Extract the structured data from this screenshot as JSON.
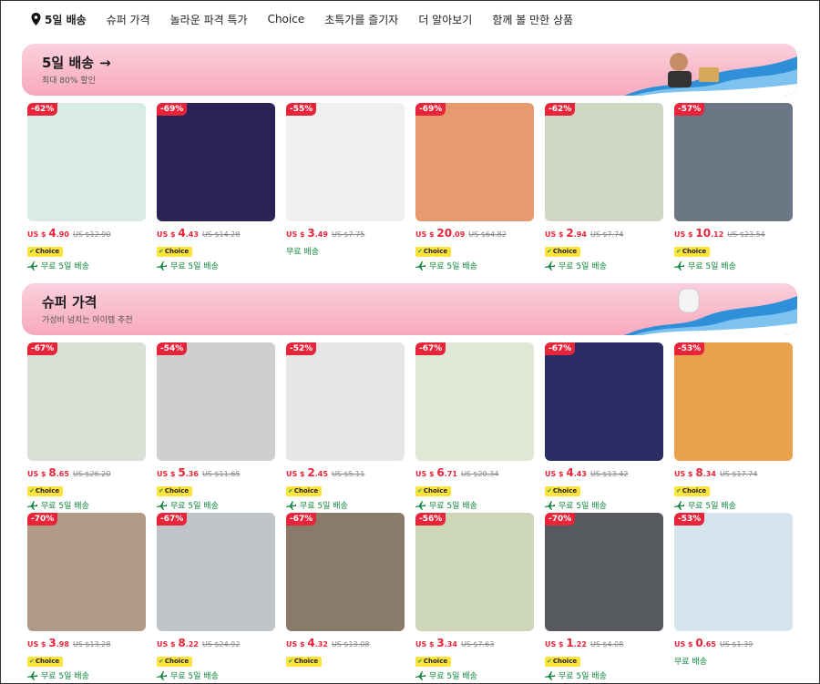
{
  "nav": [
    {
      "label": "5일 배송",
      "active": true
    },
    {
      "label": "슈퍼 가격"
    },
    {
      "label": "놀라운 파격 특가"
    },
    {
      "label": "Choice"
    },
    {
      "label": "초특가를 즐기자"
    },
    {
      "label": "더 알아보기"
    },
    {
      "label": "함께 볼 만한 상품"
    }
  ],
  "banner1": {
    "title": "5일 배송",
    "subtitle": "최대 80% 할인"
  },
  "banner2": {
    "title": "슈퍼 가격",
    "subtitle": "가성비 넘치는 아이템 추천"
  },
  "labels": {
    "currency": "US $",
    "choice": "Choice",
    "ship5": "무료 5일 배송",
    "free_ship": "무료 배송"
  },
  "row1": [
    {
      "discount": "-62%",
      "price_int": "4",
      "price_dec": ".90",
      "old": "US $12.90",
      "choice": true,
      "ship": "무료 5일 배송",
      "color": "#d9ebe5"
    },
    {
      "discount": "-69%",
      "price_int": "4",
      "price_dec": ".43",
      "old": "US $14.28",
      "choice": true,
      "ship": "무료 5일 배송",
      "color": "#2a2356"
    },
    {
      "discount": "-55%",
      "price_int": "3",
      "price_dec": ".49",
      "old": "US $7.75",
      "choice": false,
      "ship": "무료 배송",
      "color": "#efefef"
    },
    {
      "discount": "-69%",
      "price_int": "20",
      "price_dec": ".09",
      "old": "US $64.82",
      "choice": true,
      "ship": "무료 5일 배송",
      "color": "#e79a6d"
    },
    {
      "discount": "-62%",
      "price_int": "2",
      "price_dec": ".94",
      "old": "US $7.74",
      "choice": true,
      "ship": "무료 5일 배송",
      "color": "#cfd6c4"
    },
    {
      "discount": "-57%",
      "price_int": "10",
      "price_dec": ".12",
      "old": "US $23.54",
      "choice": true,
      "ship": "무료 5일 배송",
      "color": "#6b7784"
    }
  ],
  "row2": [
    {
      "discount": "-67%",
      "price_int": "8",
      "price_dec": ".65",
      "old": "US $26.20",
      "choice": true,
      "ship": "무료 5일 배송",
      "color": "#d9e0d6"
    },
    {
      "discount": "-54%",
      "price_int": "5",
      "price_dec": ".36",
      "old": "US $11.65",
      "choice": true,
      "ship": "무료 5일 배송",
      "color": "#cfcfcf"
    },
    {
      "discount": "-52%",
      "price_int": "2",
      "price_dec": ".45",
      "old": "US $5.11",
      "choice": true,
      "ship": "무료 5일 배송",
      "color": "#e6e6e6"
    },
    {
      "discount": "-67%",
      "price_int": "6",
      "price_dec": ".71",
      "old": "US $20.34",
      "choice": true,
      "ship": "무료 5일 배송",
      "color": "#dfe8d6"
    },
    {
      "discount": "-67%",
      "price_int": "4",
      "price_dec": ".43",
      "old": "US $13.42",
      "choice": true,
      "ship": "무료 5일 배송",
      "color": "#2a2d63"
    },
    {
      "discount": "-53%",
      "price_int": "8",
      "price_dec": ".34",
      "old": "US $17.74",
      "choice": true,
      "ship": "무료 5일 배송",
      "color": "#e8a24d"
    }
  ],
  "row3": [
    {
      "discount": "-70%",
      "price_int": "3",
      "price_dec": ".98",
      "old": "US $13.28",
      "choice": true,
      "ship": "무료 5일 배송",
      "color": "#b39a86"
    },
    {
      "discount": "-67%",
      "price_int": "8",
      "price_dec": ".22",
      "old": "US $24.92",
      "choice": true,
      "ship": "무료 5일 배송",
      "color": "#bfc4c8"
    },
    {
      "discount": "-67%",
      "price_int": "4",
      "price_dec": ".32",
      "old": "US $13.08",
      "choice": true,
      "ship": "",
      "color": "#8a7a6a"
    },
    {
      "discount": "-56%",
      "price_int": "3",
      "price_dec": ".34",
      "old": "US $7.63",
      "choice": true,
      "ship": "무료 5일 배송",
      "color": "#cdd7b7"
    },
    {
      "discount": "-70%",
      "price_int": "1",
      "price_dec": ".22",
      "old": "US $4.08",
      "choice": true,
      "ship": "무료 5일 배송",
      "color": "#56595d"
    },
    {
      "discount": "-53%",
      "price_int": "0",
      "price_dec": ".65",
      "old": "US $1.39",
      "choice": false,
      "ship": "무료 배송",
      "color": "#d6e4ee"
    }
  ]
}
